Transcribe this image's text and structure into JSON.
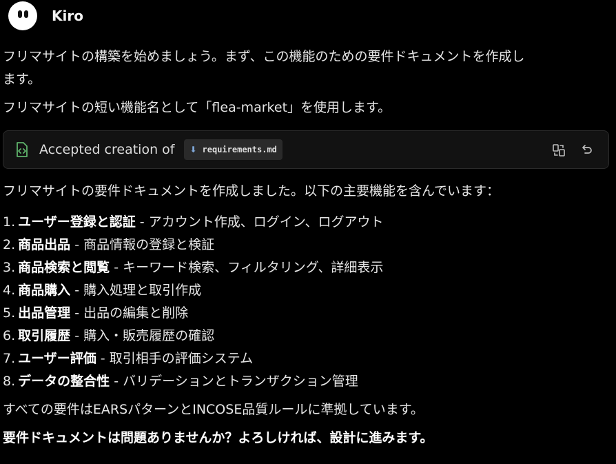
{
  "assistant": {
    "name": "Kiro"
  },
  "message": {
    "intro": "フリマサイトの構築を始めましょう。まず、この機能のための要件ドキュメントを作成し",
    "intro_cont": "ます。",
    "feature_name_line": "フリマサイトの短い機能名として「flea-market」を使用します。",
    "card": {
      "label": "Accepted creation of",
      "file_name": "requirements.md"
    },
    "summary": "フリマサイトの要件ドキュメントを作成しました。以下の主要機能を含んでいます：",
    "features": [
      {
        "num": "1.",
        "title": "ユーザー登録と認証",
        "desc": " - アカウント作成、ログイン、ログアウト"
      },
      {
        "num": "2.",
        "title": "商品出品",
        "desc": " - 商品情報の登録と検証"
      },
      {
        "num": "3.",
        "title": "商品検索と閲覧",
        "desc": " - キーワード検索、フィルタリング、詳細表示"
      },
      {
        "num": "4.",
        "title": "商品購入",
        "desc": " - 購入処理と取引作成"
      },
      {
        "num": "5.",
        "title": "出品管理",
        "desc": " - 出品の編集と削除"
      },
      {
        "num": "6.",
        "title": "取引履歴",
        "desc": " - 購入・販売履歴の確認"
      },
      {
        "num": "7.",
        "title": "ユーザー評価",
        "desc": " - 取引相手の評価システム"
      },
      {
        "num": "8.",
        "title": "データの整合性",
        "desc": " - バリデーションとトランザクション管理"
      }
    ],
    "compliance": "すべての要件はEARSパターンとINCOSE品質ルールに準拠しています。",
    "question": "要件ドキュメントは問題ありませんか？よろしければ、設計に進みます。"
  },
  "colors": {
    "background": "#000000",
    "card_bg": "#121212",
    "accent_green": "#5fb36b"
  },
  "icons": {
    "avatar": "kiro-ghost-avatar",
    "card": "file-code-icon",
    "file": "markdown-file-icon",
    "compare": "compare-changes-icon",
    "undo": "undo-icon"
  }
}
